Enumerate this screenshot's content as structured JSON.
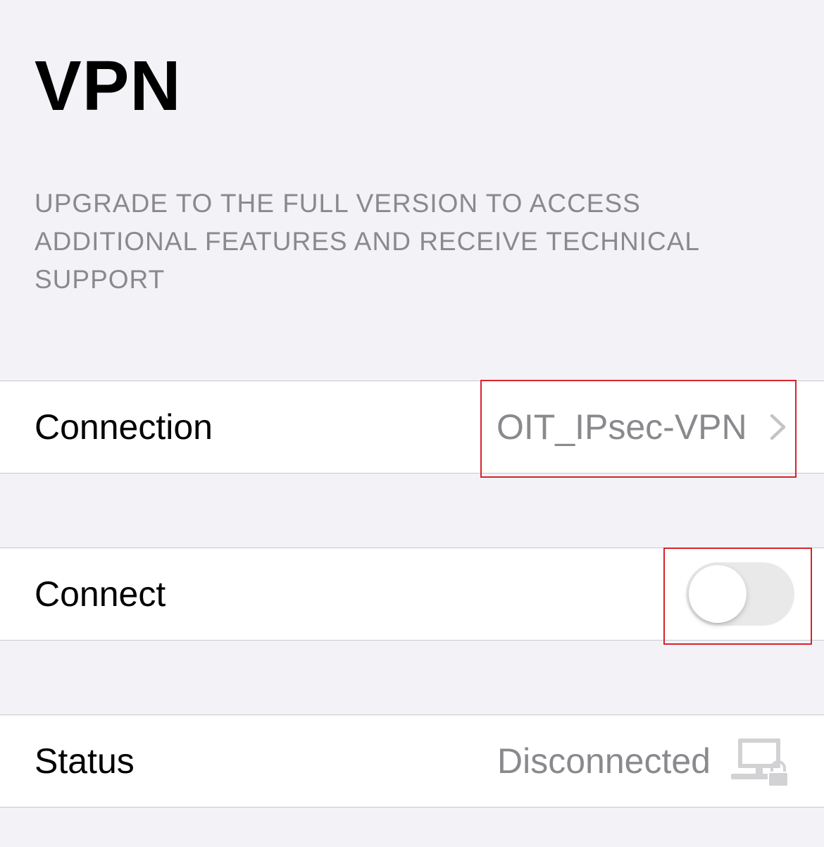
{
  "header": {
    "title": "VPN"
  },
  "upgrade_note": {
    "lines": [
      "UPGRADE TO THE FULL VERSION TO ACCESS",
      "ADDITIONAL FEATURES AND RECEIVE TECHNICAL",
      "SUPPORT"
    ]
  },
  "connection_row": {
    "label": "Connection",
    "value": "OIT_IPsec-VPN",
    "accessory_icon": "chevron-right-icon"
  },
  "connect_row": {
    "label": "Connect",
    "toggle_on": false
  },
  "status_row": {
    "label": "Status",
    "value": "Disconnected",
    "icon": "computer-lock-icon"
  },
  "colors": {
    "background": "#f2f2f7",
    "cell_background": "#ffffff",
    "secondary_text": "#8a8a8e",
    "separator": "#c8c8cc",
    "highlight_box": "#d9232e",
    "toggle_off_track": "#e9e9ea"
  }
}
